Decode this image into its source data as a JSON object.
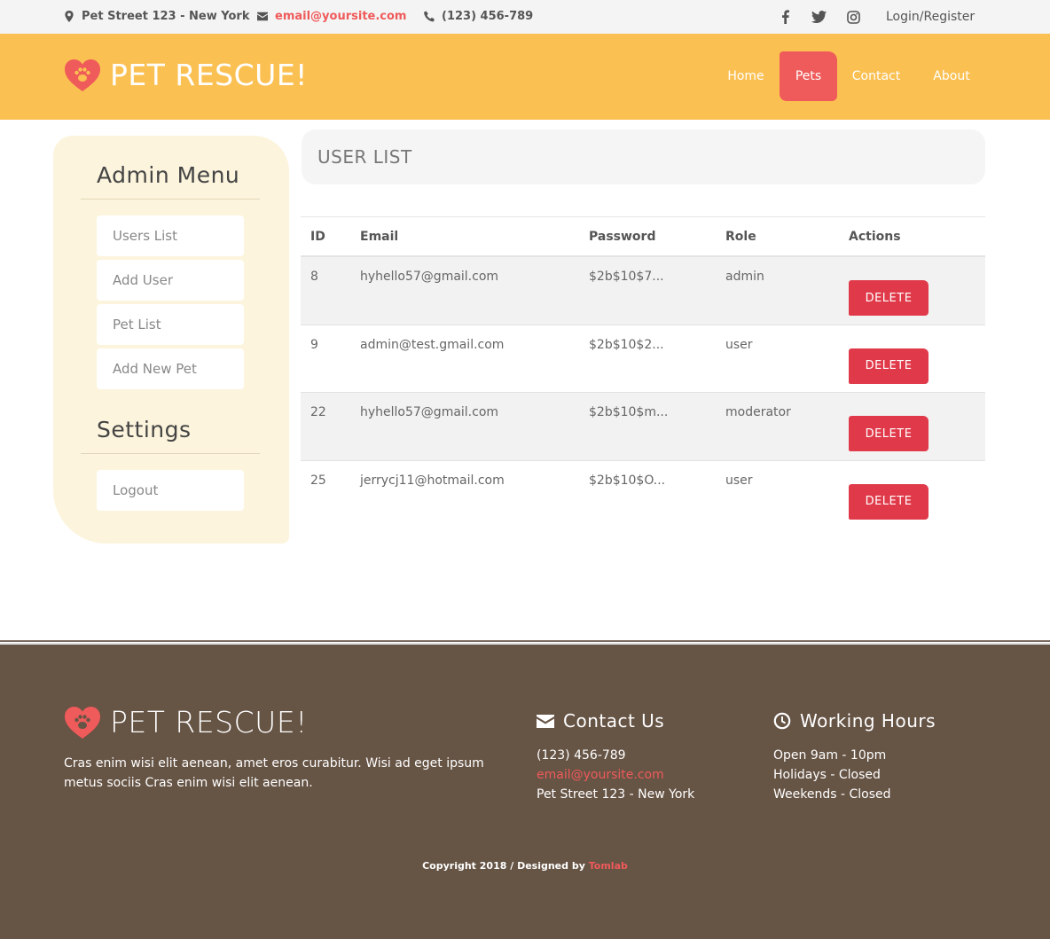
{
  "topbar": {
    "address": "Pet Street 123 - New York",
    "email": "email@yoursite.com",
    "phone": "(123) 456-789",
    "social": [
      "facebook-icon",
      "twitter-icon",
      "instagram-icon"
    ],
    "login": "Login/Register"
  },
  "brand": {
    "name": "PET RESCUE!",
    "accent": "#ef5a5a",
    "header_bg": "#fbc052",
    "footer_bg": "#665445"
  },
  "nav": {
    "items": [
      "Home",
      "Pets",
      "Contact",
      "About"
    ],
    "active": "Pets"
  },
  "sidebar": {
    "admin_title": "Admin Menu",
    "admin_items": [
      "Users List",
      "Add User",
      "Pet List",
      "Add New Pet"
    ],
    "settings_title": "Settings",
    "settings_items": [
      "Logout"
    ]
  },
  "main": {
    "title": "USER LIST",
    "columns": [
      "ID",
      "Email",
      "Password",
      "Role",
      "Actions"
    ],
    "rows": [
      {
        "id": "8",
        "email": "hyhello57@gmail.com",
        "password": "$2b$10$7...",
        "role": "admin",
        "action": "DELETE"
      },
      {
        "id": "9",
        "email": "admin@test.gmail.com",
        "password": "$2b$10$2...",
        "role": "user",
        "action": "DELETE"
      },
      {
        "id": "22",
        "email": "hyhello57@gmail.com",
        "password": "$2b$10$m...",
        "role": "moderator",
        "action": "DELETE"
      },
      {
        "id": "25",
        "email": "jerrycj11@hotmail.com",
        "password": "$2b$10$O...",
        "role": "user",
        "action": "DELETE"
      }
    ]
  },
  "footer": {
    "about": "Cras enim wisi elit aenean, amet eros curabitur. Wisi ad eget ipsum metus sociis Cras enim wisi elit aenean.",
    "contact_title": "Contact Us",
    "contact_phone": "(123) 456-789",
    "contact_email": "email@yoursite.com",
    "contact_address": "Pet Street 123 - New York",
    "hours_title": "Working Hours",
    "hours": [
      "Open 9am - 10pm",
      "Holidays - Closed",
      "Weekends - Closed"
    ],
    "copyright_prefix": "Copyright 2018 / Designed by",
    "copyright_brand": "Tomlab"
  }
}
